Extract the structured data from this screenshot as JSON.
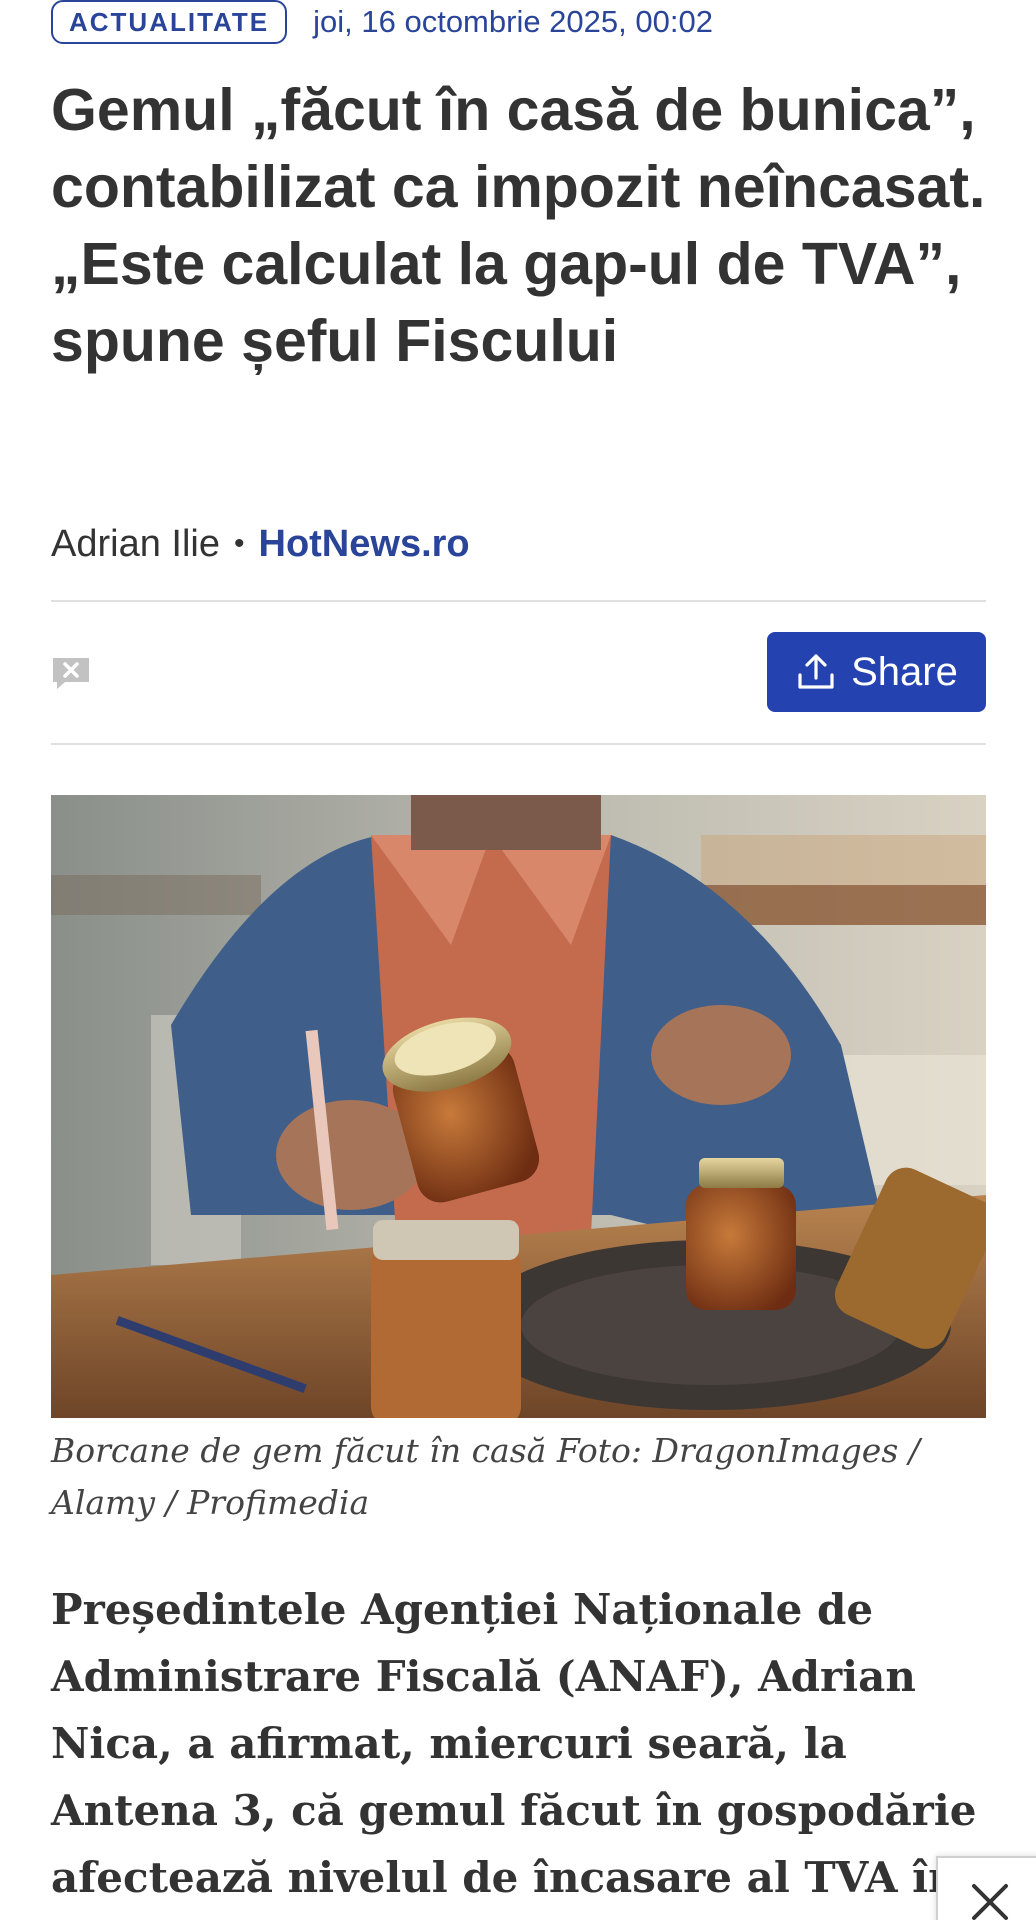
{
  "article": {
    "category": "ACTUALITATE",
    "date": "joi, 16 octombrie 2025, 00:02",
    "title": "Gemul „făcut în casă de bunica”, contabilizat ca impozit neîncasat. „Este calculat la gap-ul de TVA”, spune șeful Fiscului",
    "author": "Adrian Ilie",
    "separator": "•",
    "source": "HotNews.ro",
    "share_label": "Share",
    "image_caption": "Borcane de gem făcut în casă Foto: DragonImages / Alamy / Profimedia",
    "lead": "Președintele Agenției Naționale de Administrare Fiscală (ANAF), Adrian Nica, a afirmat, miercuri seară, la Antena 3, că gemul făcut în gospodărie afectează nivelul de încasare al TVA în"
  },
  "icons": {
    "comment": "comment-closed-icon",
    "share": "upload-share-icon",
    "close": "close-icon"
  },
  "colors": {
    "accent": "#2a4499",
    "share_button": "#2543b0",
    "text": "#333333",
    "divider": "#e0e0e0"
  }
}
